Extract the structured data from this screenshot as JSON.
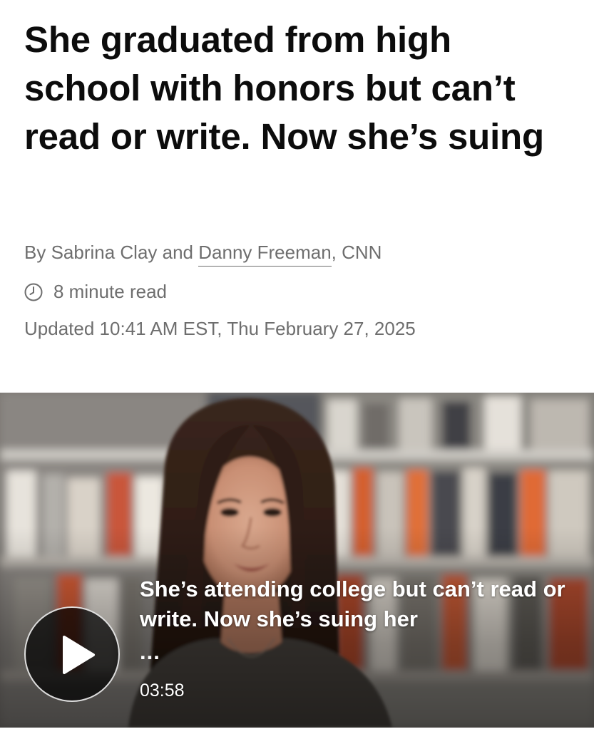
{
  "article": {
    "headline": "She graduated from high school with honors but can’t read or write. Now she’s suing",
    "byline": {
      "prefix": "By Sabrina Clay and ",
      "linked_author": "Danny Freeman",
      "suffix": ", CNN"
    },
    "read_time": "8 minute read",
    "updated": "Updated 10:41 AM EST, Thu February 27, 2025"
  },
  "video": {
    "caption": "She’s attending college but can’t read or write. Now she’s suing her",
    "ellipsis": "...",
    "duration": "03:58",
    "play_icon": "play-icon"
  },
  "icons": {
    "clock": "clock-icon",
    "play": "play-icon"
  },
  "colors": {
    "headline": "#0c0c0c",
    "meta_text": "#6e6e6e",
    "video_overlay_text": "#ffffff"
  }
}
